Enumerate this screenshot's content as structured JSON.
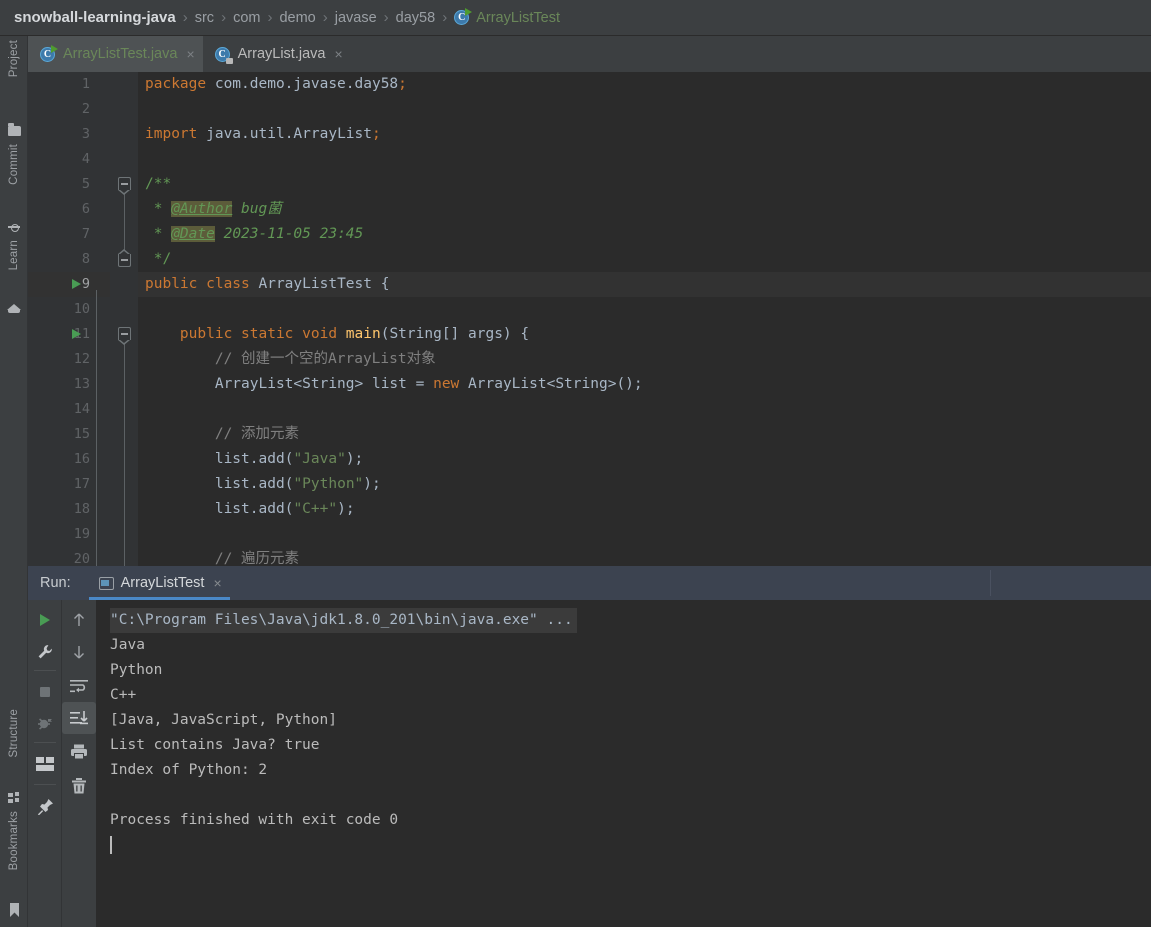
{
  "breadcrumb": {
    "name": "breadcrumb",
    "separator": "›",
    "items": [
      {
        "label": "snowball-learning-java",
        "kind": "project"
      },
      {
        "label": "src",
        "kind": "folder"
      },
      {
        "label": "com",
        "kind": "folder"
      },
      {
        "label": "demo",
        "kind": "folder"
      },
      {
        "label": "javase",
        "kind": "folder"
      },
      {
        "label": "day58",
        "kind": "folder"
      },
      {
        "label": "ArrayListTest",
        "kind": "class",
        "icon": "java-class-runnable-icon"
      }
    ]
  },
  "left_strip": {
    "top_items": [
      {
        "label": "Project",
        "icon": "folder-icon"
      },
      {
        "label": "Commit",
        "icon": "commit-icon"
      },
      {
        "label": "Learn",
        "icon": "learn-icon"
      }
    ],
    "bottom_items": [
      {
        "label": "Structure",
        "icon": "structure-icon"
      },
      {
        "label": "Bookmarks",
        "icon": "bookmark-icon"
      }
    ]
  },
  "editor_tabs": [
    {
      "label": "ArrayListTest.java",
      "icon": "java-class-runnable-icon",
      "active": true,
      "close": "×"
    },
    {
      "label": "ArrayList.java",
      "icon": "java-class-locked-icon",
      "active": false,
      "close": "×"
    }
  ],
  "editor": {
    "caret_line": 9,
    "first_visible_line": 1,
    "lines": [
      {
        "n": 1,
        "runmark": false,
        "fold": "",
        "tokens": [
          {
            "t": "package",
            "c": "kw"
          },
          {
            "t": " com.demo.javase.day58",
            "c": "txt"
          },
          {
            "t": ";",
            "c": "kw"
          }
        ]
      },
      {
        "n": 2,
        "runmark": false,
        "fold": "",
        "tokens": []
      },
      {
        "n": 3,
        "runmark": false,
        "fold": "",
        "tokens": [
          {
            "t": "import",
            "c": "kw"
          },
          {
            "t": " java.util.ArrayList",
            "c": "txt"
          },
          {
            "t": ";",
            "c": "kw"
          }
        ]
      },
      {
        "n": 4,
        "runmark": false,
        "fold": "",
        "tokens": []
      },
      {
        "n": 5,
        "runmark": false,
        "fold": "open",
        "tokens": [
          {
            "t": "/**",
            "c": "doc"
          }
        ]
      },
      {
        "n": 6,
        "runmark": false,
        "fold": "",
        "tokens": [
          {
            "t": " * ",
            "c": "doc"
          },
          {
            "t": "@Author",
            "c": "tag"
          },
          {
            "t": " bug菌",
            "c": "docit"
          }
        ]
      },
      {
        "n": 7,
        "runmark": false,
        "fold": "",
        "tokens": [
          {
            "t": " * ",
            "c": "doc"
          },
          {
            "t": "@Date",
            "c": "tag"
          },
          {
            "t": " 2023-11-05 23:45",
            "c": "docit"
          }
        ]
      },
      {
        "n": 8,
        "runmark": false,
        "fold": "close",
        "tokens": [
          {
            "t": " */",
            "c": "doc"
          }
        ]
      },
      {
        "n": 9,
        "runmark": true,
        "fold": "",
        "tokens": [
          {
            "t": "public class",
            "c": "kw"
          },
          {
            "t": " ArrayListTest {",
            "c": "txt"
          }
        ]
      },
      {
        "n": 10,
        "runmark": false,
        "fold": "",
        "tokens": []
      },
      {
        "n": 11,
        "runmark": true,
        "fold": "open",
        "tokens": [
          {
            "t": "    public static void",
            "c": "kw"
          },
          {
            "t": " ",
            "c": "txt"
          },
          {
            "t": "main",
            "c": "mth"
          },
          {
            "t": "(String[] args) {",
            "c": "txt"
          }
        ]
      },
      {
        "n": 12,
        "runmark": false,
        "fold": "",
        "tokens": [
          {
            "t": "        // 创建一个空的ArrayList对象",
            "c": "cmt"
          }
        ]
      },
      {
        "n": 13,
        "runmark": false,
        "fold": "",
        "tokens": [
          {
            "t": "        ArrayList<String> list = ",
            "c": "txt"
          },
          {
            "t": "new",
            "c": "kw"
          },
          {
            "t": " ArrayList<",
            "c": "txt"
          },
          {
            "t": "String",
            "c": "gen"
          },
          {
            "t": ">();",
            "c": "txt"
          }
        ]
      },
      {
        "n": 14,
        "runmark": false,
        "fold": "",
        "tokens": []
      },
      {
        "n": 15,
        "runmark": false,
        "fold": "",
        "tokens": [
          {
            "t": "        // 添加元素",
            "c": "cmt"
          }
        ]
      },
      {
        "n": 16,
        "runmark": false,
        "fold": "",
        "tokens": [
          {
            "t": "        list.",
            "c": "txt"
          },
          {
            "t": "add",
            "c": "txt"
          },
          {
            "t": "(",
            "c": "txt"
          },
          {
            "t": "\"Java\"",
            "c": "str"
          },
          {
            "t": ");",
            "c": "txt"
          }
        ]
      },
      {
        "n": 17,
        "runmark": false,
        "fold": "",
        "tokens": [
          {
            "t": "        list.",
            "c": "txt"
          },
          {
            "t": "add",
            "c": "txt"
          },
          {
            "t": "(",
            "c": "txt"
          },
          {
            "t": "\"Python\"",
            "c": "str"
          },
          {
            "t": ");",
            "c": "txt"
          }
        ]
      },
      {
        "n": 18,
        "runmark": false,
        "fold": "",
        "tokens": [
          {
            "t": "        list.",
            "c": "txt"
          },
          {
            "t": "add",
            "c": "txt"
          },
          {
            "t": "(",
            "c": "txt"
          },
          {
            "t": "\"C++\"",
            "c": "str"
          },
          {
            "t": ");",
            "c": "txt"
          }
        ]
      },
      {
        "n": 19,
        "runmark": false,
        "fold": "",
        "tokens": []
      },
      {
        "n": 20,
        "runmark": false,
        "fold": "",
        "tokens": [
          {
            "t": "        // 遍历元素",
            "c": "cmt"
          }
        ]
      }
    ]
  },
  "run_panel": {
    "header_label": "Run:",
    "tab": {
      "label": "ArrayListTest",
      "icon": "console-icon",
      "close": "×"
    },
    "toolbar_left": [
      {
        "icon": "run-icon",
        "name": "rerun-button"
      },
      {
        "icon": "wrench-icon",
        "name": "edit-configuration-button"
      },
      {
        "icon": "stop-icon",
        "name": "stop-button"
      },
      {
        "icon": "debug-icon",
        "name": "rerun-failed-button"
      },
      {
        "icon": "layout-icon",
        "name": "layout-settings-button"
      },
      {
        "icon": "pin-icon",
        "name": "pin-tab-button"
      }
    ],
    "toolbar_right": [
      {
        "icon": "arrow-up-icon",
        "name": "previous-occurrence-button"
      },
      {
        "icon": "arrow-down-icon",
        "name": "next-occurrence-button"
      },
      {
        "icon": "soft-wrap-icon",
        "name": "soft-wrap-button"
      },
      {
        "icon": "scroll-end-icon",
        "name": "scroll-to-end-button",
        "selected": true
      },
      {
        "icon": "print-icon",
        "name": "print-button"
      },
      {
        "icon": "trash-icon",
        "name": "clear-all-button"
      }
    ],
    "console_lines": [
      {
        "text": "\"C:\\Program Files\\Java\\jdk1.8.0_201\\bin\\java.exe\" ...",
        "kind": "command"
      },
      {
        "text": "Java",
        "kind": "stdout"
      },
      {
        "text": "Python",
        "kind": "stdout"
      },
      {
        "text": "C++",
        "kind": "stdout"
      },
      {
        "text": "[Java, JavaScript, Python]",
        "kind": "stdout"
      },
      {
        "text": "List contains Java? true",
        "kind": "stdout"
      },
      {
        "text": "Index of Python: 2",
        "kind": "stdout"
      },
      {
        "text": "",
        "kind": "stdout"
      },
      {
        "text": "Process finished with exit code 0",
        "kind": "stdout"
      }
    ]
  },
  "colors": {
    "editor_bg": "#2b2b2b",
    "gutter_bg": "#313335",
    "chrome_bg": "#3c3f41",
    "tab_active_bg": "#4e5254",
    "run_header_bg": "#3c4350",
    "accent_blue": "#4a88c7",
    "keyword_orange": "#cc7832",
    "string_green": "#6a8759",
    "javadoc_green": "#629755",
    "comment_gray": "#808080",
    "method_yellow": "#ffc66d",
    "text_default": "#a9b7c6",
    "run_green": "#499c54"
  }
}
